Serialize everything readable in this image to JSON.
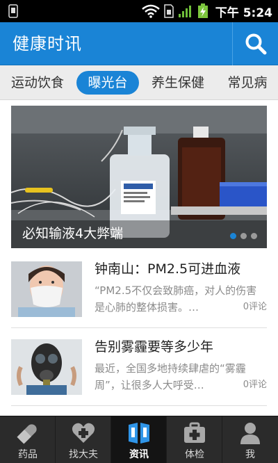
{
  "status": {
    "time": "下午 5:24"
  },
  "app": {
    "title": "健康时讯"
  },
  "tabs": [
    {
      "label": "运动饮食"
    },
    {
      "label": "曝光台"
    },
    {
      "label": "养生保健"
    },
    {
      "label": "常见病"
    }
  ],
  "hero": {
    "caption": "必知输液4大弊端"
  },
  "news": [
    {
      "headline": "钟南山：PM2.5可进血液",
      "summary": "“PM2.5不仅会致肺癌，对人的伤害是心肺的整体损害。…",
      "comments": "0评论"
    },
    {
      "headline": "告别雾霾要等多少年",
      "summary": "最近，全国多地持续肆虐的“雾霾周”，让很多人大呼受…",
      "comments": "0评论"
    }
  ],
  "nav": [
    {
      "label": "药品"
    },
    {
      "label": "找大夫"
    },
    {
      "label": "资讯"
    },
    {
      "label": "体检"
    },
    {
      "label": "我"
    }
  ],
  "colors": {
    "accent": "#1a84d6",
    "nav_bg": "#2b2b2b",
    "status_bg": "#000000"
  }
}
